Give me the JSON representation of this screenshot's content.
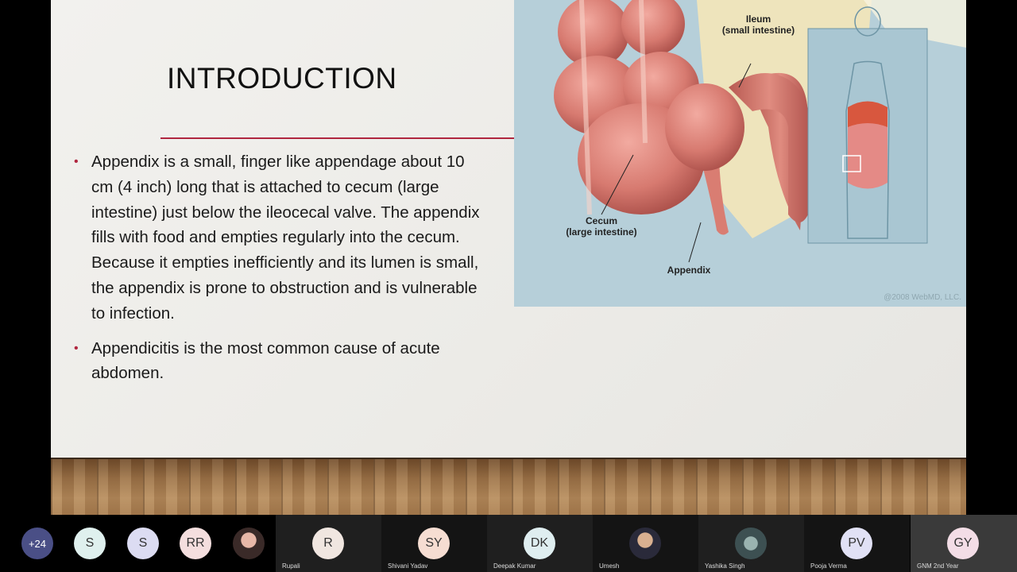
{
  "slide": {
    "title": "INTRODUCTION",
    "bullets": [
      "Appendix is a small, finger like appendage about 10 cm (4 inch) long that is attached to cecum (large intestine) just below the ileocecal valve. The appendix fills with food and empties regularly into the cecum. Because it empties inefficiently and its lumen is small, the appendix is prone to obstruction and is vulnerable to infection.",
      "Appendicitis is the most common cause of acute abdomen."
    ],
    "figure": {
      "label_ileum": "Ileum",
      "label_ileum_sub": "(small intestine)",
      "label_cecum": "Cecum",
      "label_cecum_sub": "(large intestine)",
      "label_appendix": "Appendix",
      "copyright": "@2008 WebMD, LLC."
    },
    "colors": {
      "accent": "#b0263f",
      "figure_bg": "#b6cfd9",
      "intestine": "#d77a70"
    }
  },
  "participants": {
    "overflow_count": "+24",
    "avatars": [
      {
        "initials": "S",
        "color": "#dff0ee"
      },
      {
        "initials": "S",
        "color": "#dcdcf2"
      },
      {
        "initials": "RR",
        "color": "#f4dede"
      },
      {
        "initials": "",
        "color": "#8a5a55",
        "icon": "photo-avatar-icon"
      }
    ],
    "tiles": [
      {
        "name": "Rupali",
        "initials": "R",
        "color": "#f0e6e0"
      },
      {
        "name": "Shivani Yadav",
        "initials": "SY",
        "color": "#f6ddd2"
      },
      {
        "name": "Deepak Kumar",
        "initials": "DK",
        "color": "#dfeef0"
      },
      {
        "name": "Umesh",
        "initials": "",
        "color": "#c9b29a",
        "icon": "photo-avatar-icon"
      },
      {
        "name": "Yashika Singh",
        "initials": "",
        "color": "#5a6f72",
        "icon": "photo-avatar-icon"
      },
      {
        "name": "Pooja Verma",
        "initials": "PV",
        "color": "#e1e1f5"
      },
      {
        "name": "GNM 2nd Year",
        "initials": "GY",
        "color": "#f3dde6"
      }
    ]
  }
}
